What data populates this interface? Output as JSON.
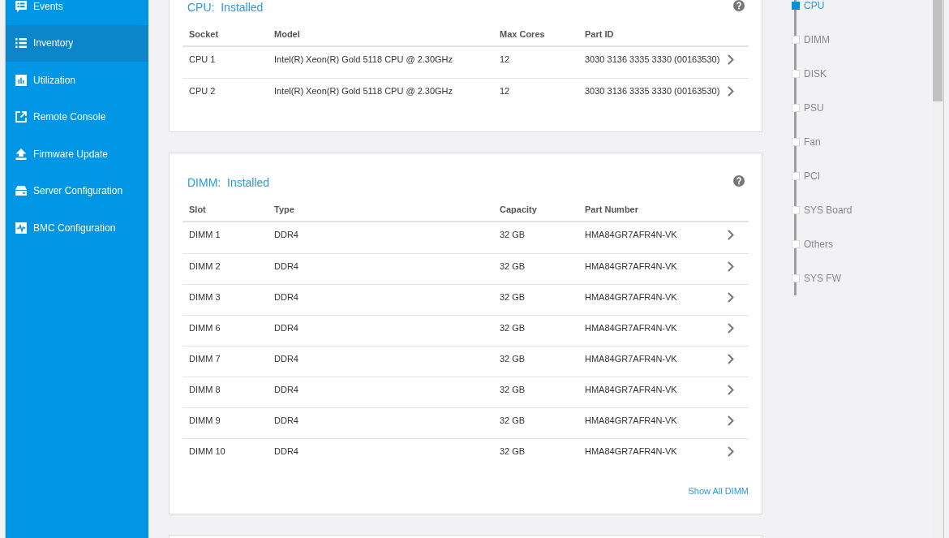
{
  "sidebar": {
    "items": [
      {
        "kind": "events",
        "label": "Events",
        "selected": false
      },
      {
        "kind": "inventory",
        "label": "Inventory",
        "selected": true
      },
      {
        "kind": "utilization",
        "label": "Utilization",
        "selected": false
      },
      {
        "kind": "remote_console",
        "label": "Remote Console",
        "selected": false
      },
      {
        "kind": "firmware_update",
        "label": "Firmware Update",
        "selected": false
      },
      {
        "kind": "server_configuration",
        "label": "Server Configuration",
        "selected": false
      },
      {
        "kind": "bmc_configuration",
        "label": "BMC Configuration",
        "selected": false
      }
    ]
  },
  "sections": [
    {
      "title": "CPU:  Installed",
      "columns": [
        "Socket",
        "Model",
        "Max Cores",
        "Part ID"
      ],
      "rows": [
        [
          "CPU 1",
          "Intel(R) Xeon(R) Gold 5118 CPU @ 2.30GHz",
          "12",
          "3030 3136 3335 3330 (00163530)"
        ],
        [
          "CPU 2",
          "Intel(R) Xeon(R) Gold 5118 CPU @ 2.30GHz",
          "12",
          "3030 3136 3335 3330 (00163530)"
        ]
      ]
    },
    {
      "title": "DIMM:  Installed",
      "columns": [
        "Slot",
        "Type",
        "Capacity",
        "Part Number"
      ],
      "rows": [
        [
          "DIMM 1",
          "DDR4",
          "32 GB",
          "HMA84GR7AFR4N-VK"
        ],
        [
          "DIMM 2",
          "DDR4",
          "32 GB",
          "HMA84GR7AFR4N-VK"
        ],
        [
          "DIMM 3",
          "DDR4",
          "32 GB",
          "HMA84GR7AFR4N-VK"
        ],
        [
          "DIMM 6",
          "DDR4",
          "32 GB",
          "HMA84GR7AFR4N-VK"
        ],
        [
          "DIMM 7",
          "DDR4",
          "32 GB",
          "HMA84GR7AFR4N-VK"
        ],
        [
          "DIMM 8",
          "DDR4",
          "32 GB",
          "HMA84GR7AFR4N-VK"
        ],
        [
          "DIMM 9",
          "DDR4",
          "32 GB",
          "HMA84GR7AFR4N-VK"
        ],
        [
          "DIMM 10",
          "DDR4",
          "32 GB",
          "HMA84GR7AFR4N-VK"
        ]
      ],
      "link": "Show All DIMM"
    }
  ],
  "section_nav": {
    "items": [
      {
        "label": "CPU",
        "selected": true
      },
      {
        "label": "DIMM",
        "selected": false
      },
      {
        "label": "DISK",
        "selected": false
      },
      {
        "label": "PSU",
        "selected": false
      },
      {
        "label": "Fan",
        "selected": false
      },
      {
        "label": "PCI",
        "selected": false
      },
      {
        "label": "SYS Board",
        "selected": false
      },
      {
        "label": "Others",
        "selected": false
      },
      {
        "label": "SYS FW",
        "selected": false
      }
    ]
  }
}
